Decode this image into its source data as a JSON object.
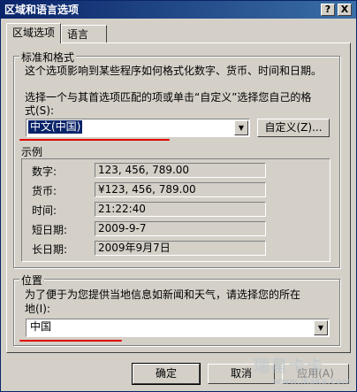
{
  "window": {
    "title": "区域和语言选项",
    "help_button": "?",
    "close_button": "X"
  },
  "tabs": [
    {
      "label": "区域选项"
    },
    {
      "label": "语言"
    }
  ],
  "standards": {
    "group_title": "标准和格式",
    "description": "这个选项影响到某些程序如何格式化数字、货币、时间和日期。",
    "select_prompt_line1": "选择一个与其首选项匹配的项或单击“自定义”选择您自己的格",
    "select_prompt_line2": "式(S):",
    "selected_value": "中文(中国)",
    "customize_button": "自定义(Z)..."
  },
  "samples": {
    "title": "示例",
    "rows": [
      {
        "label": "数字:",
        "value": "123, 456, 789.00"
      },
      {
        "label": "货币:",
        "value": "¥123, 456, 789.00"
      },
      {
        "label": "时间:",
        "value": "21:22:40"
      },
      {
        "label": "短日期:",
        "value": "2009-9-7"
      },
      {
        "label": "长日期:",
        "value": "2009年9月7日"
      }
    ]
  },
  "location": {
    "group_title": "位置",
    "description_line1": "为了便于为您提供当地信息如新闻和天气，请选择您的所在",
    "description_line2": "地(I):",
    "selected_value": "中国"
  },
  "footer": {
    "ok_label": "确定",
    "cancel_label": "取消",
    "apply_label": "应用(A)"
  },
  "watermark": {
    "brand": "瑞星卡卡",
    "site": "www.ikaka.com"
  },
  "colors": {
    "annotation_red": "#e00000",
    "selection_blue": "#0a246a"
  }
}
